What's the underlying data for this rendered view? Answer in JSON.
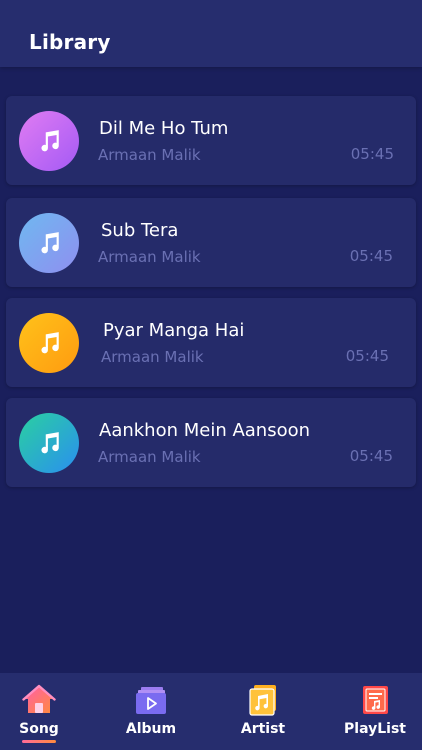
{
  "header": {
    "title": "Library"
  },
  "songs": [
    {
      "title": "Dil Me Ho Tum",
      "artist": "Armaan Malik",
      "duration": "05:45",
      "icon": "music-note-icon",
      "gradient": [
        "#e07cf2",
        "#a45af5"
      ]
    },
    {
      "title": "Sub Tera",
      "artist": "Armaan Malik",
      "duration": "05:45",
      "icon": "music-note-icon",
      "gradient": [
        "#6fb8f0",
        "#8f8ff0"
      ]
    },
    {
      "title": "Pyar Manga Hai",
      "artist": "Armaan Malik",
      "duration": "05:45",
      "icon": "music-note-icon",
      "gradient": [
        "#ffc21a",
        "#ff9b10"
      ]
    },
    {
      "title": "Aankhon Mein Aansoon",
      "artist": "Armaan Malik",
      "duration": "05:45",
      "icon": "music-note-icon",
      "gradient": [
        "#2ad0a0",
        "#2a8ff0"
      ]
    }
  ],
  "tabs": [
    {
      "label": "Song",
      "icon": "home-icon",
      "active": true
    },
    {
      "label": "Album",
      "icon": "album-icon",
      "active": false
    },
    {
      "label": "Artist",
      "icon": "artist-icon",
      "active": false
    },
    {
      "label": "PlayList",
      "icon": "playlist-icon",
      "active": false
    }
  ]
}
